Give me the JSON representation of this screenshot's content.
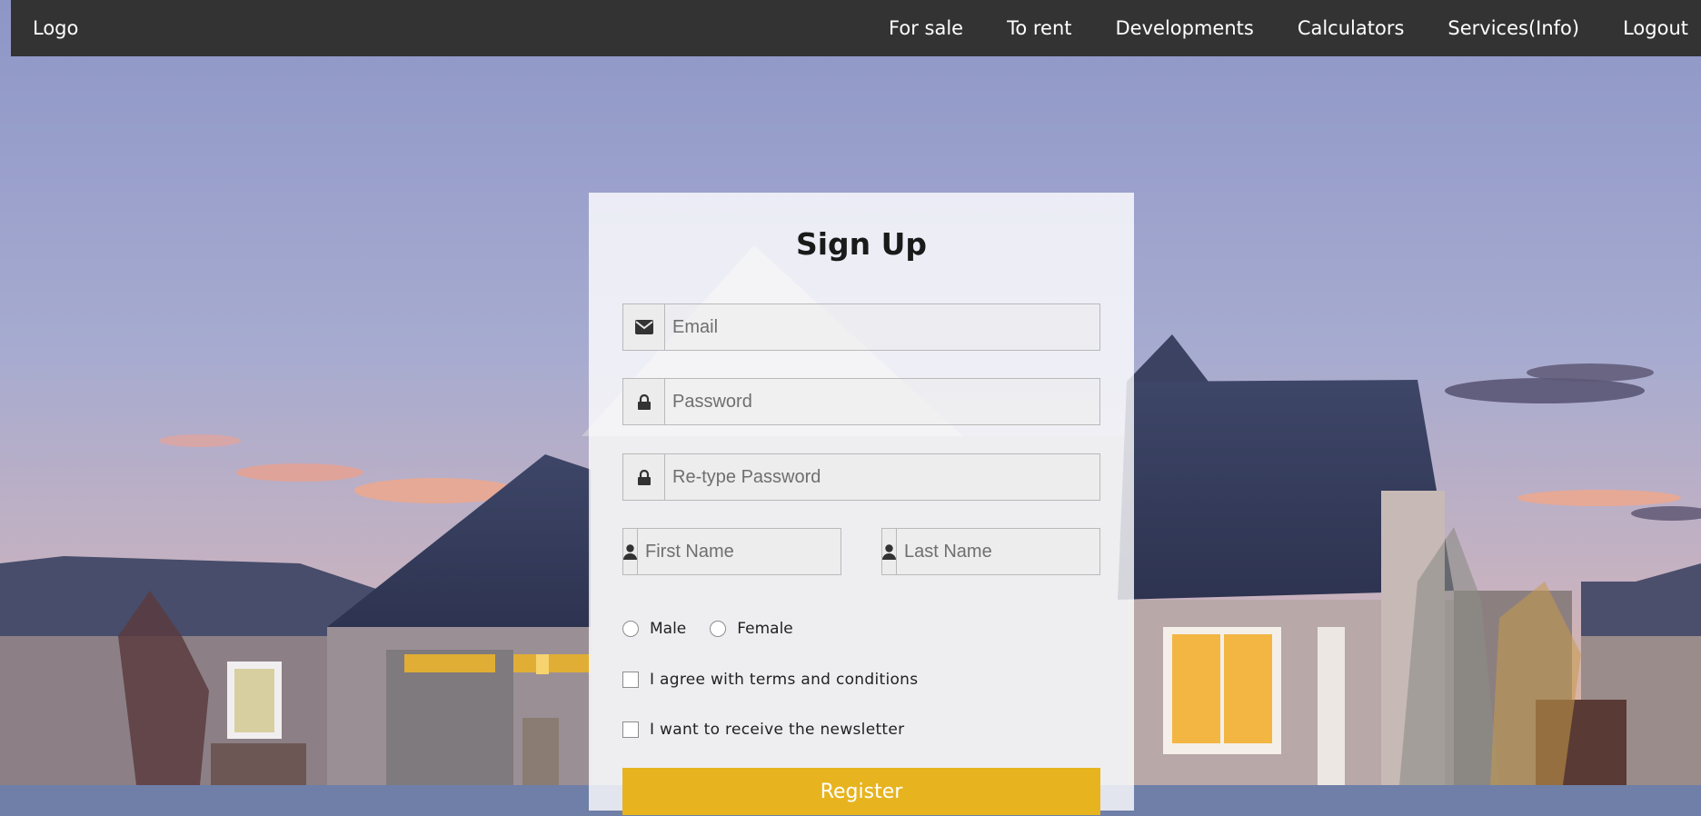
{
  "navbar": {
    "logo": "Logo",
    "links": [
      "For sale",
      "To rent",
      "Developments",
      "Calculators",
      "Services(Info)",
      "Logout"
    ]
  },
  "signup": {
    "title": "Sign Up",
    "email_placeholder": "Email",
    "password_placeholder": "Password",
    "retype_password_placeholder": "Re-type Password",
    "first_name_placeholder": "First Name",
    "last_name_placeholder": "Last Name",
    "gender_options": [
      "Male",
      "Female"
    ],
    "terms_label": "I agree with terms and conditions",
    "newsletter_label": "I want to receive the newsletter",
    "submit_label": "Register"
  },
  "colors": {
    "navbar_bg": "#333333",
    "accent": "#e7b420",
    "card_bg": "rgba(255,255,255,0.80)"
  },
  "icons": {
    "email": "envelope-icon",
    "password": "lock-icon",
    "retype_password": "lock-icon",
    "first_name": "user-icon",
    "last_name": "user-icon"
  }
}
